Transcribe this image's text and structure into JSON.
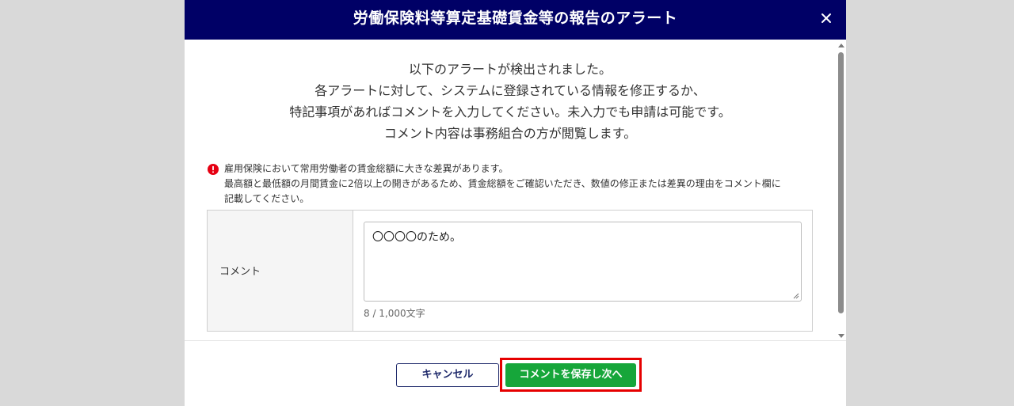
{
  "dialog": {
    "title": "労働保険料等算定基礎賃金等の報告のアラート",
    "close_label": "×"
  },
  "intro": {
    "lines": [
      "以下のアラートが検出されました。",
      "各アラートに対して、システムに登録されている情報を修正するか、",
      "特記事項があればコメントを入力してください。未入力でも申請は可能です。",
      "コメント内容は事務組合の方が閲覧します。"
    ]
  },
  "alert": {
    "lines": [
      "雇用保険において常用労働者の賃金総額に大きな差異があります。",
      "最高額と最低額の月間賃金に2倍以上の開きがあるため、賃金総額をご確認いただき、数値の修正または差異の理由をコメント欄に",
      "記載してください。"
    ],
    "icon": "exclamation-circle-icon",
    "icon_color": "#e60012"
  },
  "comment": {
    "label": "コメント",
    "value": "〇〇〇〇のため。",
    "char_count": "8 / 1,000文字"
  },
  "footer": {
    "cancel_label": "キャンセル",
    "save_label": "コメントを保存し次へ"
  },
  "colors": {
    "header_bg": "#000066",
    "save_bg": "#16a63a",
    "highlight": "#e60000",
    "cancel_border": "#1f2a6b"
  }
}
